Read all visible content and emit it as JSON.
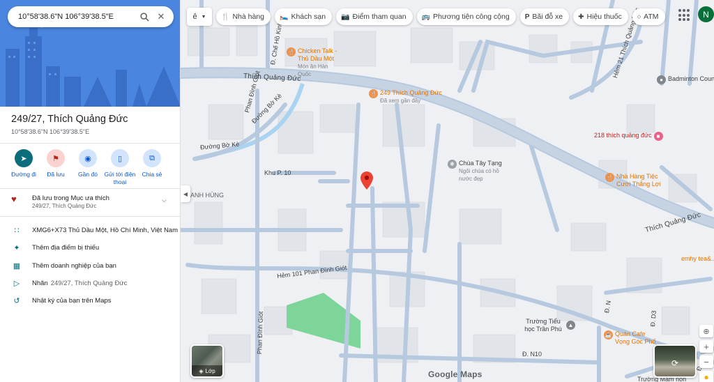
{
  "search": {
    "value": "10°58'38.6\"N 106°39'38.5\"E"
  },
  "place": {
    "title": "249/27, Thích Quảng Đức",
    "coords": "10°58'38.6\"N 106°39'38.5\"E"
  },
  "actions": [
    {
      "label": "Đường đi",
      "icon": "directions-icon"
    },
    {
      "label": "Đã lưu",
      "icon": "bookmark-icon"
    },
    {
      "label": "Gần đó",
      "icon": "nearby-icon"
    },
    {
      "label": "Gửi tới điện thoại",
      "icon": "phone-icon"
    },
    {
      "label": "Chia sẻ",
      "icon": "share-icon"
    }
  ],
  "saved": {
    "title": "Đã lưu trong Mục ưa thích",
    "subtitle": "249/27, Thích Quảng Đức"
  },
  "info_rows": [
    {
      "icon": "plus-code-icon",
      "text": "XMG6+X73 Thủ Dầu Một, Hồ Chí Minh, Việt Nam"
    },
    {
      "icon": "add-place-icon",
      "text": "Thêm địa điểm bị thiếu"
    },
    {
      "icon": "add-business-icon",
      "text": "Thêm doanh nghiệp của bạn"
    },
    {
      "icon": "label-icon",
      "text": "Nhãn",
      "extra": "249/27, Thích Quảng Đức"
    },
    {
      "icon": "history-icon",
      "text": "Nhật ký của bạn trên Maps"
    }
  ],
  "lang_button": "ê",
  "chips": [
    {
      "label": "Nhà hàng",
      "icon": "restaurant-icon"
    },
    {
      "label": "Khách sạn",
      "icon": "hotel-icon"
    },
    {
      "label": "Điểm tham quan",
      "icon": "camera-icon"
    },
    {
      "label": "Phương tiện công cộng",
      "icon": "transit-icon"
    },
    {
      "label": "Bãi đỗ xe",
      "icon": "parking-icon"
    },
    {
      "label": "Hiệu thuốc",
      "icon": "pharmacy-icon"
    },
    {
      "label": "ATM",
      "icon": "atm-icon"
    }
  ],
  "avatar_letter": "N",
  "layers_label": "Lớp",
  "google_logo": "Google Maps",
  "map": {
    "roads": {
      "thich_quang_duc_1": "Thích Quảng Đức",
      "thich_quang_duc_2": "Thích Quảng Đức",
      "phan_dinh_giot_1": "Phan Đình Giót",
      "phan_dinh_giot_2": "Phan Đình Giót",
      "duong_bo_ke_1": "Đường Bờ Kè",
      "duong_bo_ke_2": "Đường Bờ Kè",
      "chu_ho_kinh": "Đ. Chế Hồ Kinh",
      "khu_p10": "Khu P. 10",
      "hem_101": "Hẻm 101 Phan Đình Giót",
      "hem_21": "Hẻm 21 Thích Quảng Đức",
      "d_n10": "Đ. N10",
      "d_n_1": "Đ. N",
      "d_n_2": "Đ. N",
      "d_d3": "Đ. D3"
    },
    "pois": {
      "chicken_talk_name": "Chicken Talk - Thủ Dầu Một",
      "chicken_talk_sub": "Món ăn Hàn Quốc",
      "tqd249_name": "249 Thích Quảng Đức",
      "tqd249_sub": "Đã xem gần đây",
      "chua_tay_tang_name": "Chùa Tây Tạng",
      "chua_tay_tang_sub": "Ngôi chùa có hồ nước đẹp",
      "tqd218_name": "218 thích quảng đức",
      "nha_hang_tiec_name": "Nhà Hàng Tiệc Cưới Thắng Lợi",
      "badminton": "Badminton Court",
      "truong_tieu_hoc": "Trường Tiểu học Trần Phú",
      "quan_cafe": "Quán Cafe Vọng Góc Phố",
      "emhy": "emhy tea&...",
      "truong_mam_non": "Trường Mầm non",
      "anh_hung": "ANH HÙNG"
    }
  },
  "colors": {
    "accent": "#0b57d0",
    "teal": "#0b6e7a",
    "saved_red": "#b3261e",
    "hero_blue": "#4a86e0",
    "park_green": "#7ed59a",
    "road_blue": "#b7c9df"
  }
}
